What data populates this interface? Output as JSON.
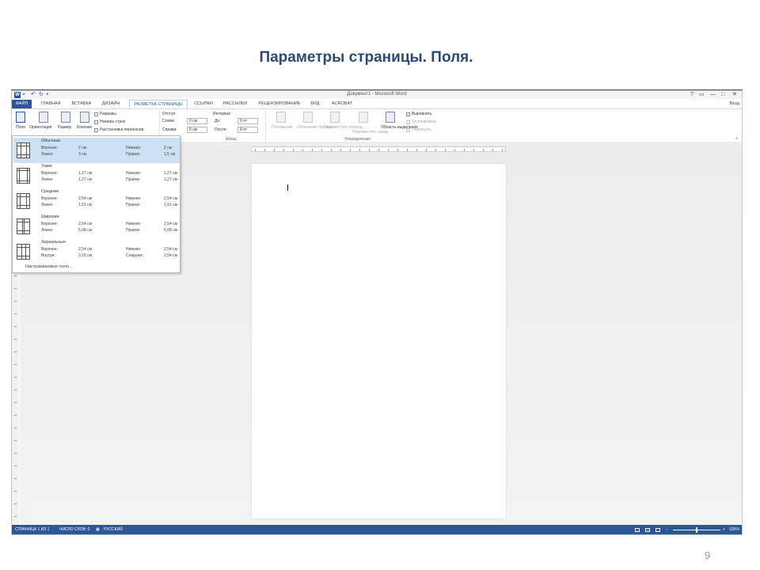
{
  "slide": {
    "title": "Параметры страницы. Поля.",
    "page_number": "9"
  },
  "window": {
    "doc_title": "Документ1 - Microsoft Word",
    "controls": {
      "help": "?",
      "ribbon_opts": "▭",
      "minimize": "—",
      "maximize": "□",
      "close": "✕"
    },
    "signin": "Вход"
  },
  "tabs": [
    "ФАЙЛ",
    "ГЛАВНАЯ",
    "ВСТАВКА",
    "ДИЗАЙН",
    "РАЗМЕТКА СТРАНИЦЫ",
    "ССЫЛКИ",
    "РАССЫЛКИ",
    "РЕЦЕНЗИРОВАНИЕ",
    "ВИД",
    "ACROBAT"
  ],
  "ribbon": {
    "page_setup": {
      "margins": "Поля",
      "orientation": "Ориентация",
      "size": "Размер",
      "columns": "Колонки",
      "breaks": "Разрывы",
      "line_numbers": "Номера строк",
      "hyphenation": "Расстановка переносов"
    },
    "paragraph": {
      "indent_header": "Отступ",
      "spacing_header": "Интервал",
      "left_label": "Слева:",
      "left_value": "0 см",
      "right_label": "Справа:",
      "right_value": "0 см",
      "before_label": "До:",
      "before_value": "0 пт",
      "after_label": "После:",
      "after_value": "8 пт",
      "group_label": "Абзац"
    },
    "arrange": {
      "position": "Положение",
      "wrap_text": "Обтекание текстом",
      "bring_forward": "Переместить вперед",
      "send_backward": "Переместить назад",
      "selection_pane": "Область выделения",
      "align": "Выровнять",
      "group": "Группировать",
      "rotate": "Повернуть",
      "group_label": "Упорядочение"
    }
  },
  "margins_menu": {
    "items": [
      {
        "name": "Обычные",
        "selected": true,
        "top_label": "Верхнее:",
        "top": "2 см",
        "bottom_label": "Нижнее:",
        "bottom": "2 см",
        "left_label": "Левое:",
        "left": "3 см",
        "right_label": "Правое:",
        "right": "1,5 см"
      },
      {
        "name": "Узкие",
        "selected": false,
        "top_label": "Верхнее:",
        "top": "1,27 см",
        "bottom_label": "Нижнее:",
        "bottom": "1,27 см",
        "left_label": "Левое:",
        "left": "1,27 см",
        "right_label": "Правое:",
        "right": "1,27 см"
      },
      {
        "name": "Средние",
        "selected": false,
        "top_label": "Верхнее:",
        "top": "2,54 см",
        "bottom_label": "Нижнее:",
        "bottom": "2,54 см",
        "left_label": "Левое:",
        "left": "1,91 см",
        "right_label": "Правое:",
        "right": "1,91 см"
      },
      {
        "name": "Широкие",
        "selected": false,
        "top_label": "Верхнее:",
        "top": "2,54 см",
        "bottom_label": "Нижнее:",
        "bottom": "2,54 см",
        "left_label": "Левое:",
        "left": "5,08 см",
        "right_label": "Правое:",
        "right": "5,08 см"
      },
      {
        "name": "Зеркальные",
        "selected": false,
        "top_label": "Верхнее:",
        "top": "2,54 см",
        "bottom_label": "Нижнее:",
        "bottom": "2,54 см",
        "left_label": "Внутри:",
        "left": "3,18 см",
        "right_label": "Снаружи:",
        "right": "2,54 см"
      }
    ],
    "custom": "Настраиваемые поля..."
  },
  "statusbar": {
    "page": "СТРАНИЦА 1 ИЗ 1",
    "words": "ЧИСЛО СЛОВ: 0",
    "language": "РУССКИЙ",
    "zoom": "100%"
  }
}
